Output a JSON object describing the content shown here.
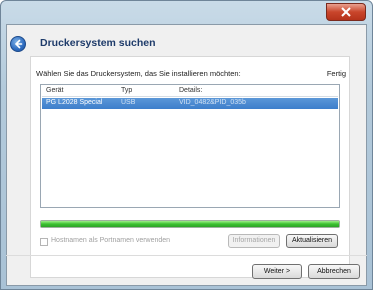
{
  "window": {
    "title": "Druckersystem suchen",
    "close_glyph": "x"
  },
  "header": {
    "instruction": "Wählen Sie das Druckersystem, das Sie installieren möchten:",
    "status": "Fertig"
  },
  "table": {
    "columns": [
      "Gerät",
      "Typ",
      "Details:"
    ],
    "rows": [
      {
        "device": "PG L2028 Special",
        "type": "USB",
        "details": "VID_0482&PID_035b",
        "selected": true
      }
    ]
  },
  "progress": {
    "value_percent": 100,
    "color": "#3cc130"
  },
  "options": {
    "hostname_checkbox_label": "Hostnamen als Portnamen verwenden",
    "hostname_checked": false
  },
  "buttons": {
    "info": "Informationen",
    "refresh": "Aktualisieren",
    "next": "Weiter >",
    "cancel": "Abbrechen"
  },
  "icons": {
    "back": "back-arrow-icon",
    "close": "close-icon"
  }
}
